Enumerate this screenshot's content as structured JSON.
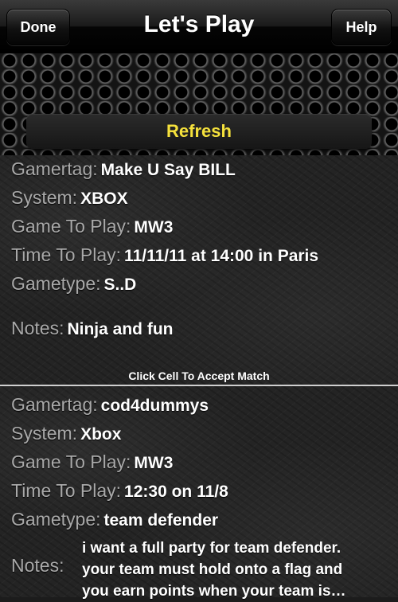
{
  "navbar": {
    "title": "Let's Play",
    "left_button": "Done",
    "right_button": "Help"
  },
  "refresh_label": "Refresh",
  "colors": {
    "refresh_text": "#f5e13c",
    "label_text": "#a9a9a9",
    "value_text": "#ffffff"
  },
  "matches": [
    {
      "gamertag_label": "Gamertag:",
      "gamertag": "Make U Say BILL",
      "system_label": "System:",
      "system": "XBOX",
      "game_label": "Game To Play:",
      "game": "MW3",
      "time_label": "Time To Play:",
      "time": "11/11/11 at 14:00 in Paris",
      "gametype_label": "Gametype:",
      "gametype": "S..D",
      "notes_label": "Notes:",
      "notes": "Ninja and fun",
      "hint": "Click Cell To Accept Match"
    },
    {
      "gamertag_label": "Gamertag:",
      "gamertag": "cod4dummys",
      "system_label": "System:",
      "system": "Xbox",
      "game_label": "Game To Play:",
      "game": "MW3",
      "time_label": "Time To Play:",
      "time": "12:30 on 11/8",
      "gametype_label": "Gametype:",
      "gametype": "team defender",
      "notes_label": "Notes:",
      "notes_lines": [
        "i want a full party for team defender.",
        "your team must hold onto a flag and",
        "you earn points when your team is…"
      ]
    }
  ]
}
